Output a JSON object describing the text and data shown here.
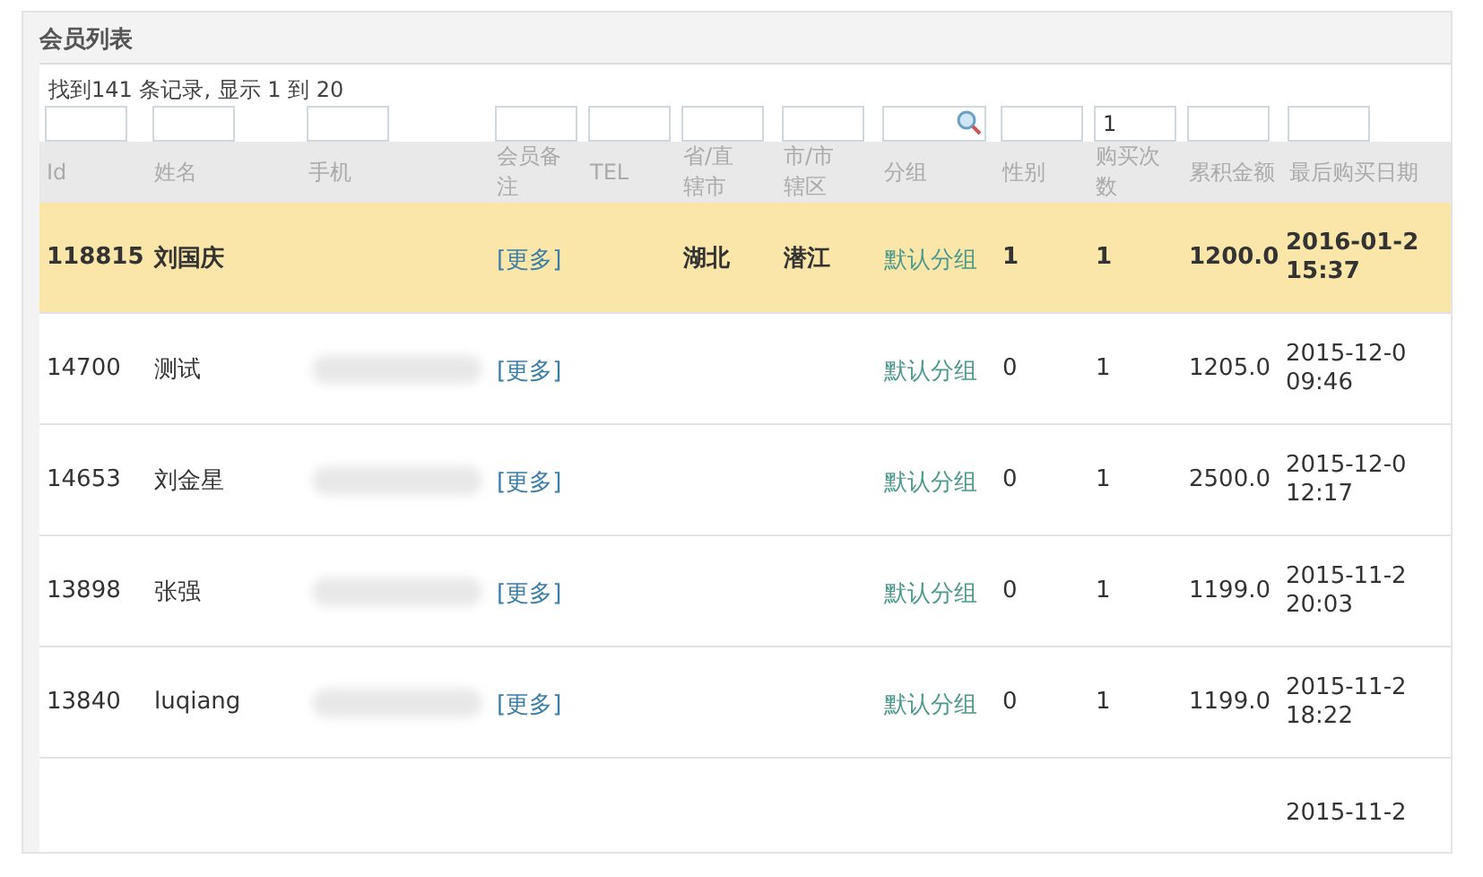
{
  "panel": {
    "title": "会员列表"
  },
  "summary": "找到141 条记录, 显示 1 到 20",
  "filters": [
    {
      "kind": "text"
    },
    {
      "kind": "text"
    },
    {
      "kind": "text"
    },
    {
      "kind": "text"
    },
    {
      "kind": "text"
    },
    {
      "kind": "text"
    },
    {
      "kind": "text"
    },
    {
      "kind": "search"
    },
    {
      "kind": "text"
    },
    {
      "kind": "text",
      "value": "1"
    },
    {
      "kind": "text"
    },
    {
      "kind": "text"
    }
  ],
  "columns": [
    "Id",
    "姓名",
    "手机",
    "会员备注",
    "TEL",
    "省/直辖市",
    "市/市辖区",
    "分组",
    "性别",
    "购买次数",
    "累积金额",
    "最后购买日期"
  ],
  "rows": [
    {
      "selected": true,
      "phone_masked": false,
      "id": "118815",
      "name": "刘国庆",
      "note": "[更多]",
      "province": "湖北",
      "city": "潜江",
      "group": "默认分组",
      "gender": "1",
      "purchases": "1",
      "total": "1200.0",
      "date": "2016-01-2",
      "time": "15:37"
    },
    {
      "selected": false,
      "phone_masked": true,
      "id": "14700",
      "name": "测试",
      "note": "[更多]",
      "group": "默认分组",
      "gender": "0",
      "purchases": "1",
      "total": "1205.0",
      "date": "2015-12-0",
      "time": "09:46"
    },
    {
      "selected": false,
      "phone_masked": true,
      "id": "14653",
      "name": "刘金星",
      "note": "[更多]",
      "group": "默认分组",
      "gender": "0",
      "purchases": "1",
      "total": "2500.0",
      "date": "2015-12-0",
      "time": "12:17"
    },
    {
      "selected": false,
      "phone_masked": true,
      "id": "13898",
      "name": "张强",
      "note": "[更多]",
      "group": "默认分组",
      "gender": "0",
      "purchases": "1",
      "total": "1199.0",
      "date": "2015-11-2",
      "time": "20:03"
    },
    {
      "selected": false,
      "phone_masked": true,
      "id": "13840",
      "name": "luqiang",
      "note": "[更多]",
      "group": "默认分组",
      "gender": "0",
      "purchases": "1",
      "total": "1199.0",
      "date": "2015-11-2",
      "time": "18:22"
    },
    {
      "selected": false,
      "phone_masked": false,
      "date": "2015-11-2"
    }
  ]
}
